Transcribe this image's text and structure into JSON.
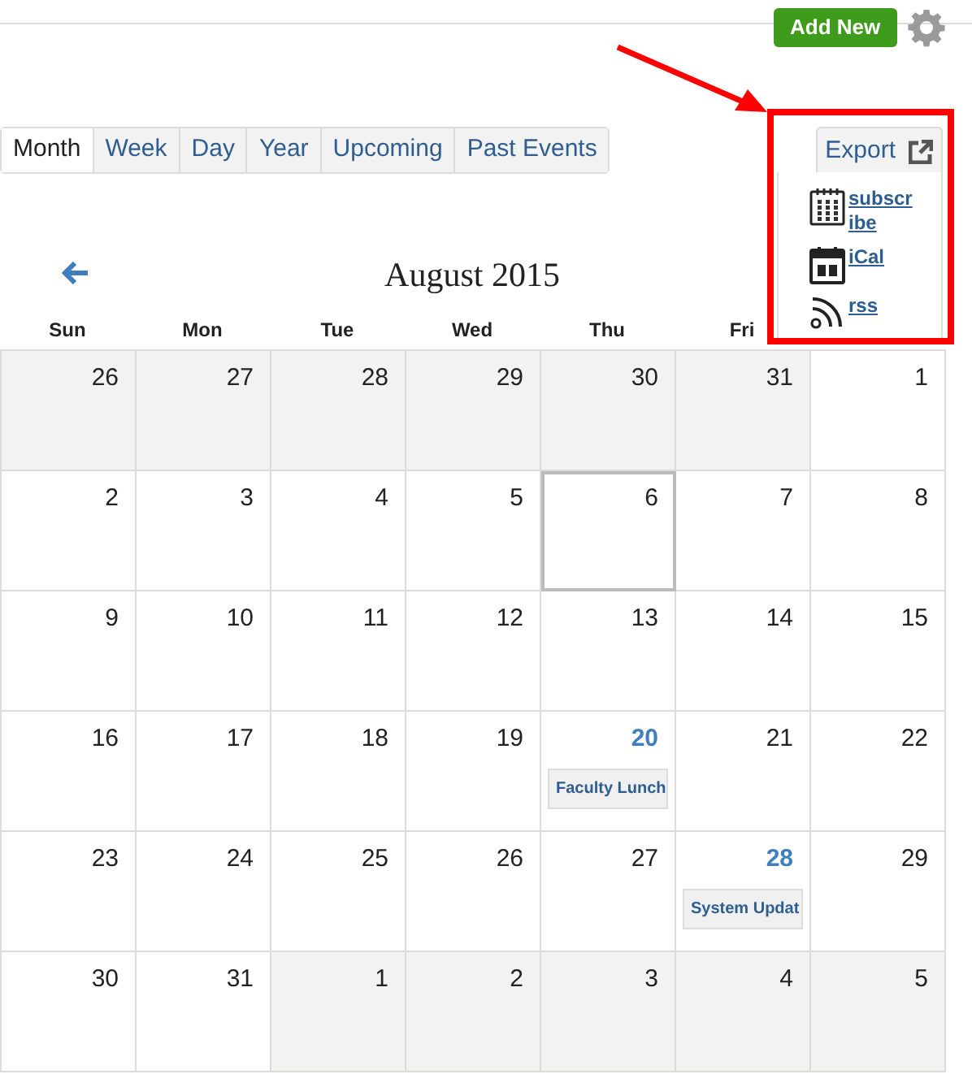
{
  "toolbar": {
    "add_button": "Add New"
  },
  "tabs": [
    {
      "label": "Month",
      "selected": true
    },
    {
      "label": "Week",
      "selected": false
    },
    {
      "label": "Day",
      "selected": false
    },
    {
      "label": "Year",
      "selected": false
    },
    {
      "label": "Upcoming",
      "selected": false
    },
    {
      "label": "Past Events",
      "selected": false
    }
  ],
  "export": {
    "label": "Export",
    "items": [
      {
        "kind": "subscribe",
        "label": "subscribe"
      },
      {
        "kind": "ical",
        "label": "iCal"
      },
      {
        "kind": "rss",
        "label": "rss"
      }
    ]
  },
  "calendar": {
    "title": "August 2015",
    "weekdays": [
      "Sun",
      "Mon",
      "Tue",
      "Wed",
      "Thu",
      "Fri"
    ],
    "weeks": [
      [
        {
          "day": "26",
          "outside": true,
          "today": false
        },
        {
          "day": "27",
          "outside": true,
          "today": false
        },
        {
          "day": "28",
          "outside": true,
          "today": false
        },
        {
          "day": "29",
          "outside": true,
          "today": false
        },
        {
          "day": "30",
          "outside": true,
          "today": false
        },
        {
          "day": "31",
          "outside": true,
          "today": false
        },
        {
          "day": "1",
          "outside": false,
          "today": false
        }
      ],
      [
        {
          "day": "2",
          "outside": false,
          "today": false
        },
        {
          "day": "3",
          "outside": false,
          "today": false
        },
        {
          "day": "4",
          "outside": false,
          "today": false
        },
        {
          "day": "5",
          "outside": false,
          "today": false
        },
        {
          "day": "6",
          "outside": false,
          "today": true
        },
        {
          "day": "7",
          "outside": false,
          "today": false
        },
        {
          "day": "8",
          "outside": false,
          "today": false
        }
      ],
      [
        {
          "day": "9",
          "outside": false,
          "today": false
        },
        {
          "day": "10",
          "outside": false,
          "today": false
        },
        {
          "day": "11",
          "outside": false,
          "today": false
        },
        {
          "day": "12",
          "outside": false,
          "today": false
        },
        {
          "day": "13",
          "outside": false,
          "today": false
        },
        {
          "day": "14",
          "outside": false,
          "today": false
        },
        {
          "day": "15",
          "outside": false,
          "today": false
        }
      ],
      [
        {
          "day": "16",
          "outside": false,
          "today": false
        },
        {
          "day": "17",
          "outside": false,
          "today": false
        },
        {
          "day": "18",
          "outside": false,
          "today": false
        },
        {
          "day": "19",
          "outside": false,
          "today": false
        },
        {
          "day": "20",
          "outside": false,
          "today": false,
          "events": [
            "Faculty Lunch"
          ]
        },
        {
          "day": "21",
          "outside": false,
          "today": false
        },
        {
          "day": "22",
          "outside": false,
          "today": false
        }
      ],
      [
        {
          "day": "23",
          "outside": false,
          "today": false
        },
        {
          "day": "24",
          "outside": false,
          "today": false
        },
        {
          "day": "25",
          "outside": false,
          "today": false
        },
        {
          "day": "26",
          "outside": false,
          "today": false
        },
        {
          "day": "27",
          "outside": false,
          "today": false
        },
        {
          "day": "28",
          "outside": false,
          "today": false,
          "events": [
            "System Updat"
          ]
        },
        {
          "day": "29",
          "outside": false,
          "today": false
        }
      ],
      [
        {
          "day": "30",
          "outside": false,
          "today": false
        },
        {
          "day": "31",
          "outside": false,
          "today": false
        },
        {
          "day": "1",
          "outside": true,
          "today": false
        },
        {
          "day": "2",
          "outside": true,
          "today": false
        },
        {
          "day": "3",
          "outside": true,
          "today": false
        },
        {
          "day": "4",
          "outside": true,
          "today": false
        },
        {
          "day": "5",
          "outside": true,
          "today": false
        }
      ]
    ]
  }
}
